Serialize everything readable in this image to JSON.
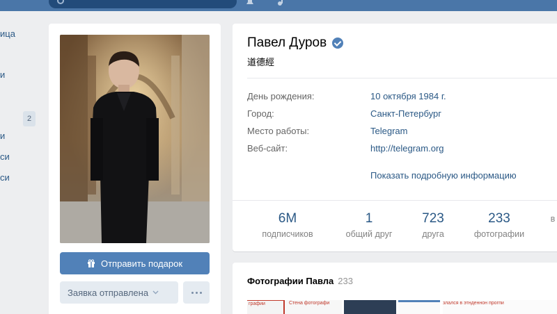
{
  "menu": {
    "items": [
      {
        "label": "ица"
      },
      {
        "label": "и"
      },
      {
        "label": "и"
      },
      {
        "label": "си"
      },
      {
        "label": "си"
      }
    ],
    "badge": "2"
  },
  "profile": {
    "name": "Павел Дуров",
    "status": "道德經",
    "info": [
      {
        "label": "День рождения:",
        "value": "10 октября 1984 г."
      },
      {
        "label": "Город:",
        "value": "Санкт-Петербург"
      },
      {
        "label": "Место работы:",
        "value": "Telegram"
      },
      {
        "label": "Веб-сайт:",
        "value": "http://telegram.org"
      }
    ],
    "show_more": "Показать подробную информацию",
    "counters": [
      {
        "num": "6M",
        "caption": "подписчиков"
      },
      {
        "num": "1",
        "caption": "общий друг"
      },
      {
        "num": "723",
        "caption": "друга"
      },
      {
        "num": "233",
        "caption": "фотографии"
      },
      {
        "num": "",
        "caption": "в"
      }
    ]
  },
  "actions": {
    "gift_label": "Отправить подарок",
    "request_label": "Заявка отправлена"
  },
  "photos": {
    "title": "Фотографии Павла",
    "count": "233",
    "thumb_texts": [
      "графии",
      "Стена фотографи",
      "злался в этнденнон прогпи"
    ]
  },
  "colors": {
    "header": "#4a76a8",
    "accent": "#5181b8",
    "link": "#2a5885",
    "background": "#edeef0"
  }
}
